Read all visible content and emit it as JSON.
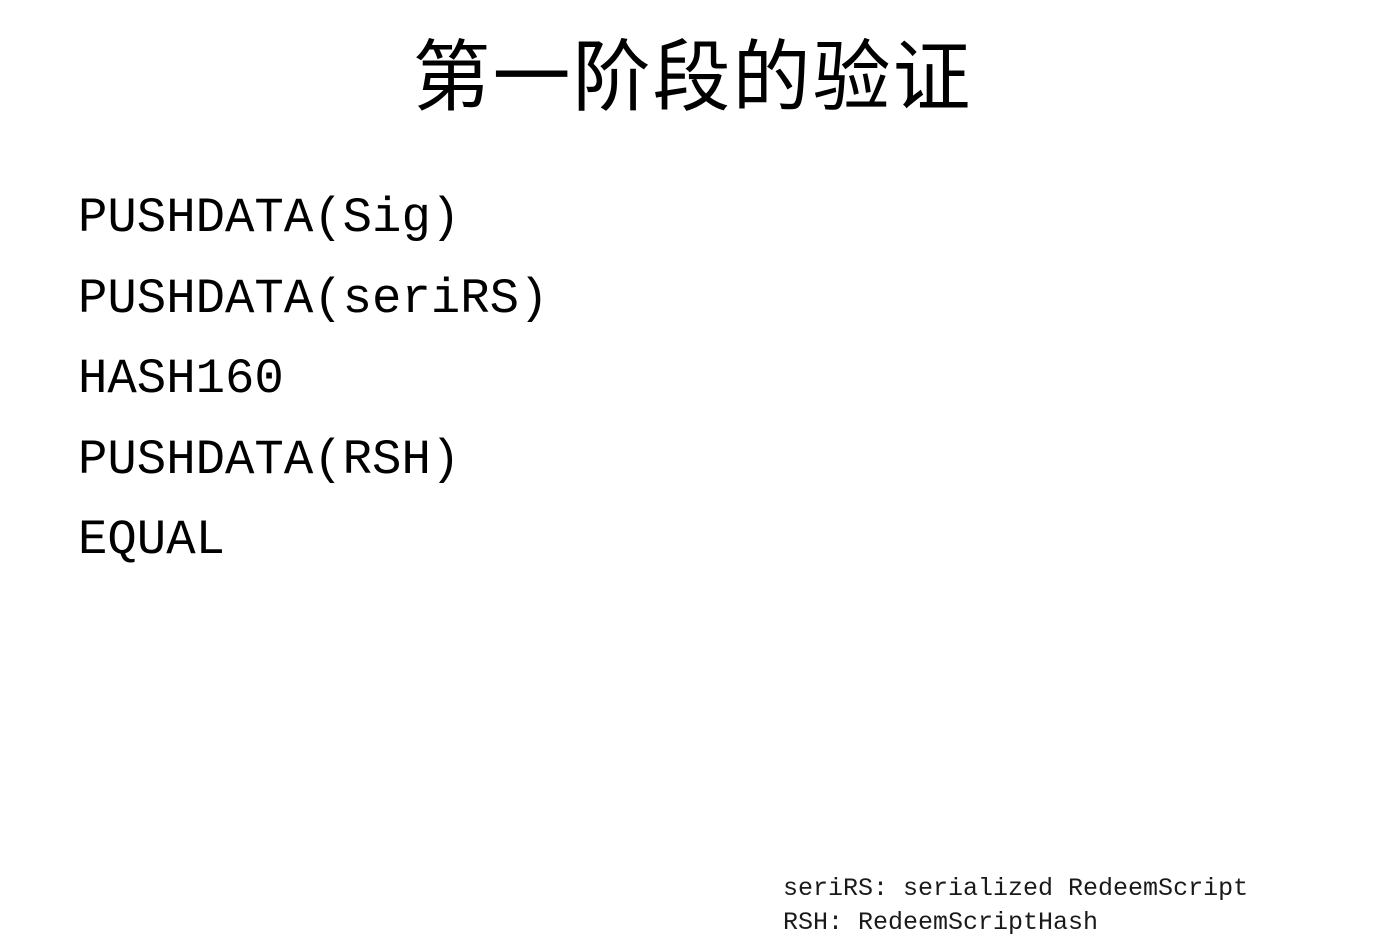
{
  "slide": {
    "title": "第一阶段的验证",
    "code_lines": [
      "PUSHDATA(Sig)",
      "PUSHDATA(seriRS)",
      "HASH160",
      "PUSHDATA(RSH)",
      "EQUAL"
    ],
    "footnotes": [
      "seriRS: serialized RedeemScript",
      "RSH: RedeemScriptHash"
    ]
  }
}
